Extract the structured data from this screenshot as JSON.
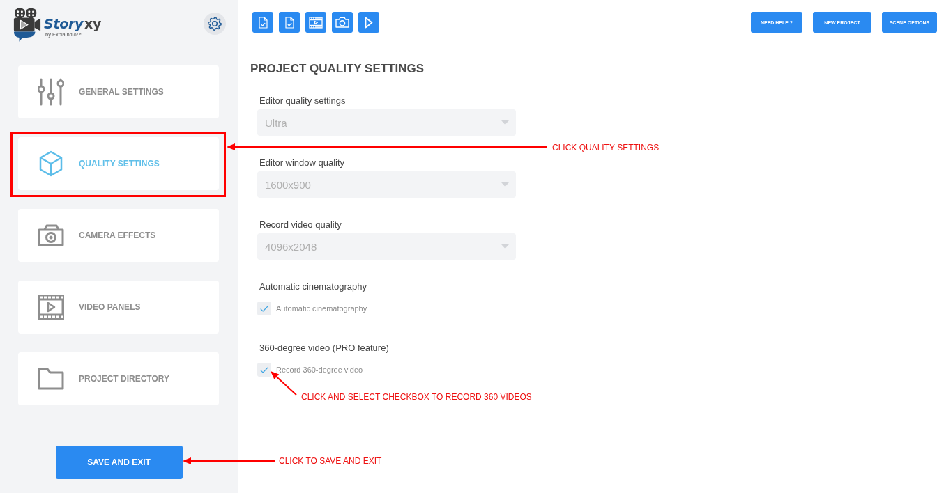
{
  "sidebar": {
    "logo": {
      "name_parts": [
        "Story",
        "xy"
      ],
      "byline": "by Explaindio™"
    },
    "items": [
      {
        "label": "GENERAL SETTINGS",
        "selected": false
      },
      {
        "label": "QUALITY SETTINGS",
        "selected": true
      },
      {
        "label": "CAMERA EFFECTS",
        "selected": false
      },
      {
        "label": "VIDEO PANELS",
        "selected": false
      },
      {
        "label": "PROJECT DIRECTORY",
        "selected": false
      }
    ],
    "save_button": "SAVE AND EXIT"
  },
  "toolbar": {
    "buttons": [
      "NEED HELP ?",
      "NEW PROJECT",
      "SCENE OPTIONS"
    ]
  },
  "settings": {
    "title": "PROJECT QUALITY SETTINGS",
    "fields": [
      {
        "kind": "select",
        "label": "Editor quality settings",
        "value": "Ultra"
      },
      {
        "kind": "select",
        "label": "Editor window quality",
        "value": "1600x900"
      },
      {
        "kind": "select",
        "label": "Record video quality",
        "value": "4096x2048"
      },
      {
        "kind": "checkbox",
        "label": "Automatic cinematography",
        "option": "Automatic cinematography",
        "checked": true
      },
      {
        "kind": "checkbox",
        "label": "360-degree video (PRO feature)",
        "option": "Record 360-degree video",
        "checked": true
      }
    ]
  },
  "annotations": [
    {
      "text": "CLICK QUALITY SETTINGS"
    },
    {
      "text": "CLICK AND SELECT CHECKBOX TO RECORD 360 VIDEOS"
    },
    {
      "text": "CLICK TO SAVE AND EXIT"
    }
  ]
}
